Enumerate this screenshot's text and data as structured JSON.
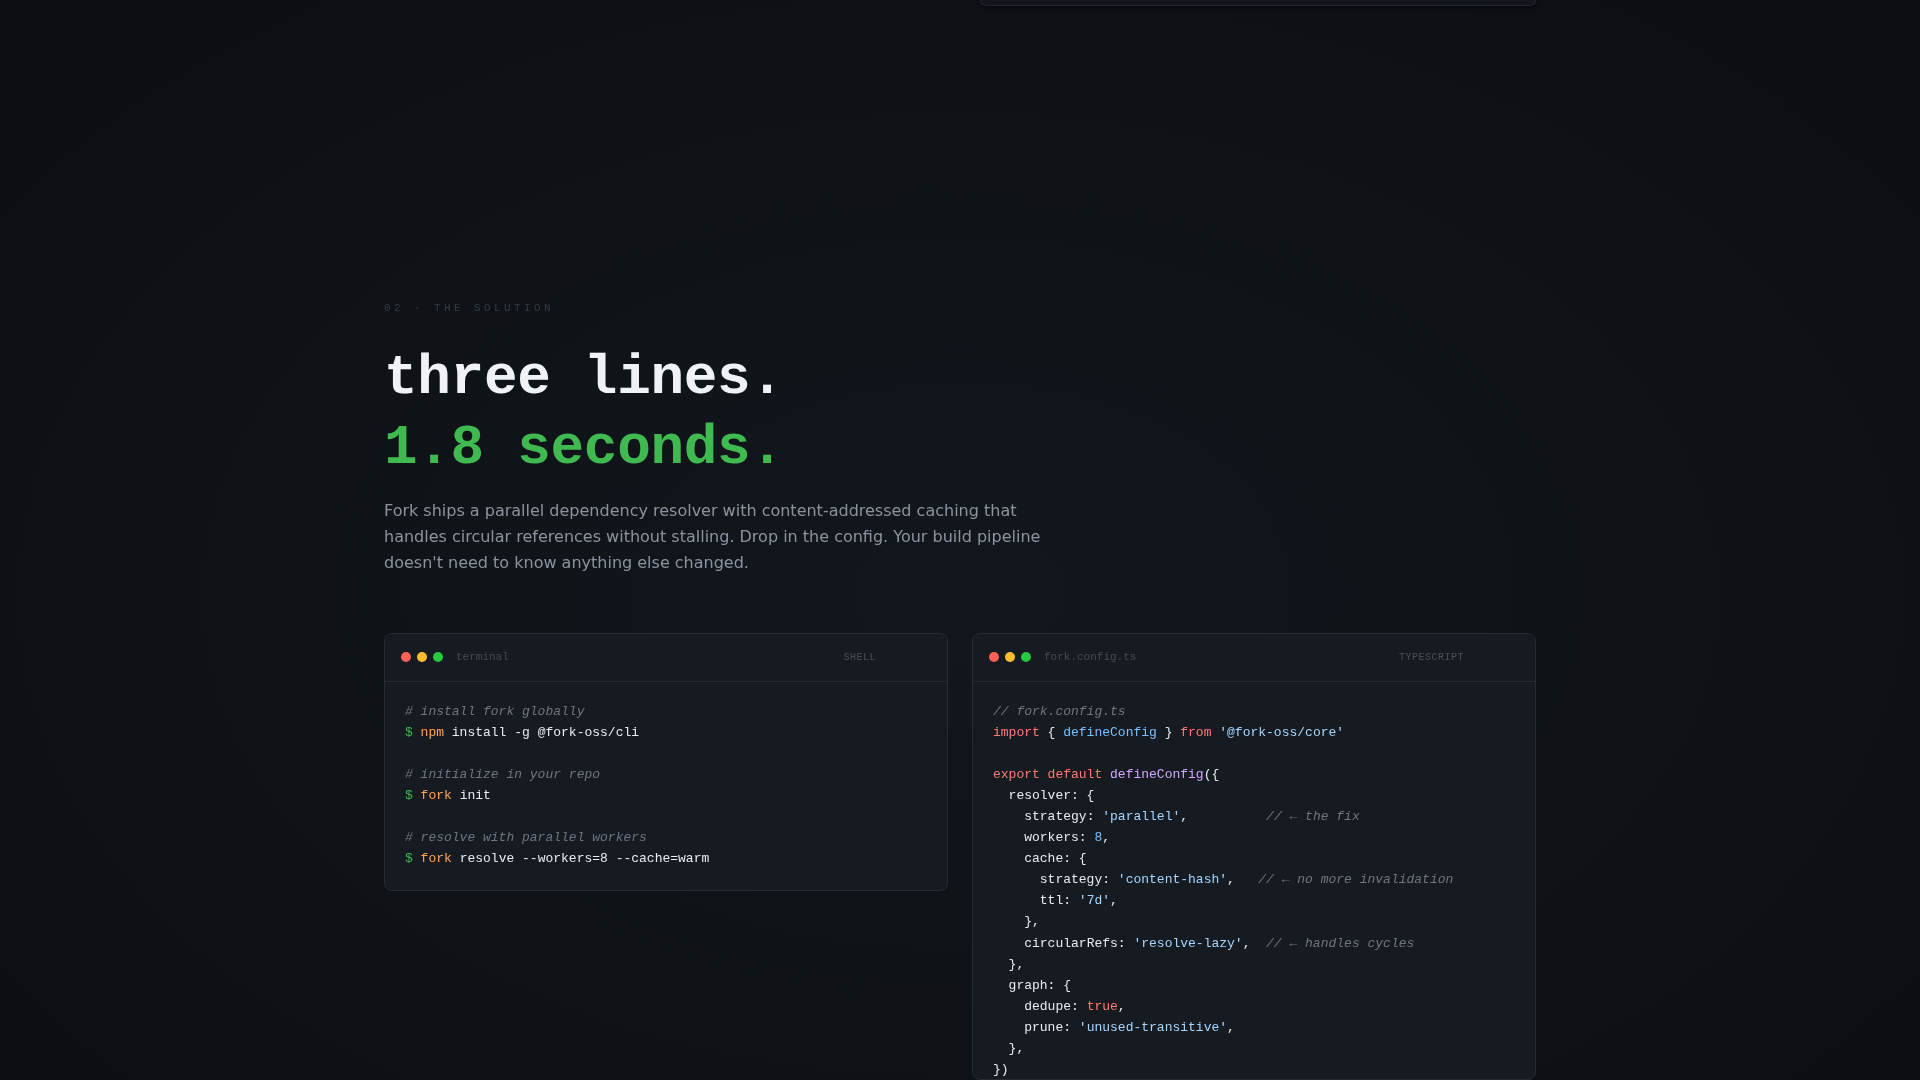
{
  "section": {
    "eyebrow": "02 · THE SOLUTION",
    "headline": [
      {
        "kind": "plain",
        "text": "three lines."
      },
      {
        "kind": "highlight",
        "text": "1.8 seconds."
      }
    ],
    "description": "Fork ships a parallel dependency resolver with content-addressed caching that handles circular references without stalling. Drop in the config. Your build pipeline doesn't need to know anything else changed.",
    "panels": [
      {
        "title": "terminal",
        "language": "SHELL",
        "blocks": [
          {
            "lines": [
              {
                "tokens": [
                  {
                    "kind": "comment",
                    "text": "# install fork globally"
                  }
                ]
              },
              {
                "tokens": [
                  {
                    "kind": "prompt",
                    "text": "$ "
                  },
                  {
                    "kind": "command",
                    "text": "npm"
                  },
                  {
                    "kind": "plain",
                    "text": " install -g @fork-oss/cli"
                  }
                ]
              }
            ]
          },
          {
            "lines": [
              {
                "tokens": [
                  {
                    "kind": "comment",
                    "text": "# initialize in your repo"
                  }
                ]
              },
              {
                "tokens": [
                  {
                    "kind": "prompt",
                    "text": "$ "
                  },
                  {
                    "kind": "command",
                    "text": "fork"
                  },
                  {
                    "kind": "plain",
                    "text": " init"
                  }
                ]
              }
            ]
          },
          {
            "lines": [
              {
                "tokens": [
                  {
                    "kind": "comment",
                    "text": "# resolve with parallel workers"
                  }
                ]
              },
              {
                "tokens": [
                  {
                    "kind": "prompt",
                    "text": "$ "
                  },
                  {
                    "kind": "command",
                    "text": "fork"
                  },
                  {
                    "kind": "plain",
                    "text": " resolve --workers=8 --cache=warm"
                  }
                ]
              }
            ]
          }
        ]
      },
      {
        "title": "fork.config.ts",
        "language": "TYPESCRIPT",
        "blocks": [
          {
            "lines": [
              {
                "tokens": [
                  {
                    "kind": "comment",
                    "text": "// fork.config.ts"
                  }
                ]
              },
              {
                "tokens": [
                  {
                    "kind": "keyword",
                    "text": "import"
                  },
                  {
                    "kind": "plain",
                    "text": " { "
                  },
                  {
                    "kind": "name",
                    "text": "defineConfig"
                  },
                  {
                    "kind": "plain",
                    "text": " } "
                  },
                  {
                    "kind": "keyword",
                    "text": "from "
                  },
                  {
                    "kind": "string",
                    "text": "'@fork-oss/core'"
                  }
                ]
              }
            ]
          },
          {
            "lines": [
              {
                "tokens": [
                  {
                    "kind": "keyword",
                    "text": "export default "
                  },
                  {
                    "kind": "function",
                    "text": "defineConfig"
                  },
                  {
                    "kind": "plain",
                    "text": "({"
                  }
                ]
              },
              {
                "tokens": [
                  {
                    "kind": "plain",
                    "text": "  resolver: {"
                  }
                ]
              },
              {
                "tokens": [
                  {
                    "kind": "plain",
                    "text": "    strategy: "
                  },
                  {
                    "kind": "string",
                    "text": "'parallel'"
                  },
                  {
                    "kind": "plain",
                    "text": ",          "
                  },
                  {
                    "kind": "comment",
                    "text": "// ← the fix"
                  }
                ]
              },
              {
                "tokens": [
                  {
                    "kind": "plain",
                    "text": "    workers: "
                  },
                  {
                    "kind": "number",
                    "text": "8"
                  },
                  {
                    "kind": "plain",
                    "text": ","
                  }
                ]
              },
              {
                "tokens": [
                  {
                    "kind": "plain",
                    "text": "    cache: {"
                  }
                ]
              },
              {
                "tokens": [
                  {
                    "kind": "plain",
                    "text": "      strategy: "
                  },
                  {
                    "kind": "string",
                    "text": "'content-hash'"
                  },
                  {
                    "kind": "plain",
                    "text": ",   "
                  },
                  {
                    "kind": "comment",
                    "text": "// ← no more invalidation"
                  }
                ]
              },
              {
                "tokens": [
                  {
                    "kind": "plain",
                    "text": "      ttl: "
                  },
                  {
                    "kind": "string",
                    "text": "'7d'"
                  },
                  {
                    "kind": "plain",
                    "text": ","
                  }
                ]
              },
              {
                "tokens": [
                  {
                    "kind": "plain",
                    "text": "    },"
                  }
                ]
              },
              {
                "tokens": [
                  {
                    "kind": "plain",
                    "text": "    circularRefs: "
                  },
                  {
                    "kind": "string",
                    "text": "'resolve-lazy'"
                  },
                  {
                    "kind": "plain",
                    "text": ",  "
                  },
                  {
                    "kind": "comment",
                    "text": "// ← handles cycles"
                  }
                ]
              },
              {
                "tokens": [
                  {
                    "kind": "plain",
                    "text": "  },"
                  }
                ]
              },
              {
                "tokens": [
                  {
                    "kind": "plain",
                    "text": "  graph: {"
                  }
                ]
              },
              {
                "tokens": [
                  {
                    "kind": "plain",
                    "text": "    dedupe: "
                  },
                  {
                    "kind": "keyword",
                    "text": "true"
                  },
                  {
                    "kind": "plain",
                    "text": ","
                  }
                ]
              },
              {
                "tokens": [
                  {
                    "kind": "plain",
                    "text": "    prune: "
                  },
                  {
                    "kind": "string",
                    "text": "'unused-transitive'"
                  },
                  {
                    "kind": "plain",
                    "text": ","
                  }
                ]
              },
              {
                "tokens": [
                  {
                    "kind": "plain",
                    "text": "  },"
                  }
                ]
              },
              {
                "tokens": [
                  {
                    "kind": "plain",
                    "text": "})"
                  }
                ]
              }
            ]
          }
        ]
      }
    ]
  }
}
